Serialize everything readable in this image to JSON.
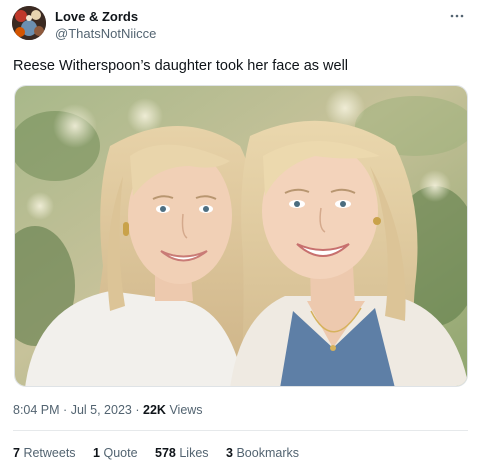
{
  "author": {
    "display_name": "Love & Zords",
    "handle": "@ThatsNotNiicce",
    "avatar_icon": "profile-avatar"
  },
  "more_icon": "more-options-icon",
  "tweet": {
    "text": "Reese Witherspoon’s daughter took her face as well"
  },
  "media": {
    "icon": "photo-two-women-smiling"
  },
  "meta": {
    "time": "8:04 PM",
    "sep1": "·",
    "date": "Jul 5, 2023",
    "sep2": "·",
    "views_count": "22K",
    "views_label": "Views"
  },
  "stats": {
    "retweets_count": "7",
    "retweets_label": "Retweets",
    "quotes_count": "1",
    "quotes_label": "Quote",
    "likes_count": "578",
    "likes_label": "Likes",
    "bookmarks_count": "3",
    "bookmarks_label": "Bookmarks"
  },
  "colors": {
    "text_primary": "#0f1419",
    "text_secondary": "#536471",
    "divider": "#e6e9eb"
  }
}
